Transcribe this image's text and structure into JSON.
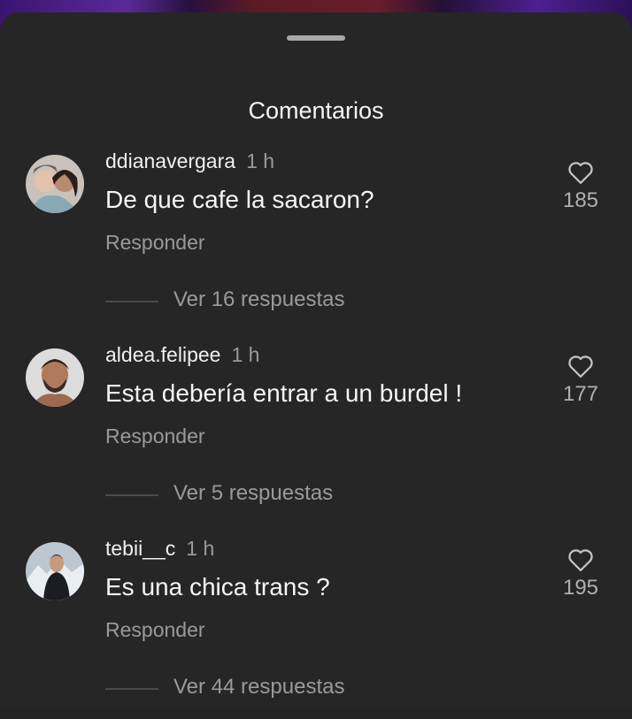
{
  "sheet": {
    "title": "Comentarios"
  },
  "comments": [
    {
      "username": "ddianavergara",
      "time": "1 h",
      "text": "De que cafe la sacaron?",
      "reply_label": "Responder",
      "likes": "185",
      "replies_label": "Ver 16 respuestas",
      "heart_icon": "heart-outline-icon"
    },
    {
      "username": "aldea.felipee",
      "time": "1 h",
      "text": "Esta debería entrar a un burdel !",
      "reply_label": "Responder",
      "likes": "177",
      "replies_label": "Ver 5 respuestas",
      "heart_icon": "heart-outline-icon"
    },
    {
      "username": "tebii__c",
      "time": "1 h",
      "text": "Es una chica trans ?",
      "reply_label": "Responder",
      "likes": "195",
      "replies_label": "Ver 44 respuestas",
      "heart_icon": "heart-outline-icon"
    }
  ],
  "colors": {
    "background": "#262626",
    "primary_text": "#f5f5f5",
    "secondary_text": "#9a9a9a"
  }
}
